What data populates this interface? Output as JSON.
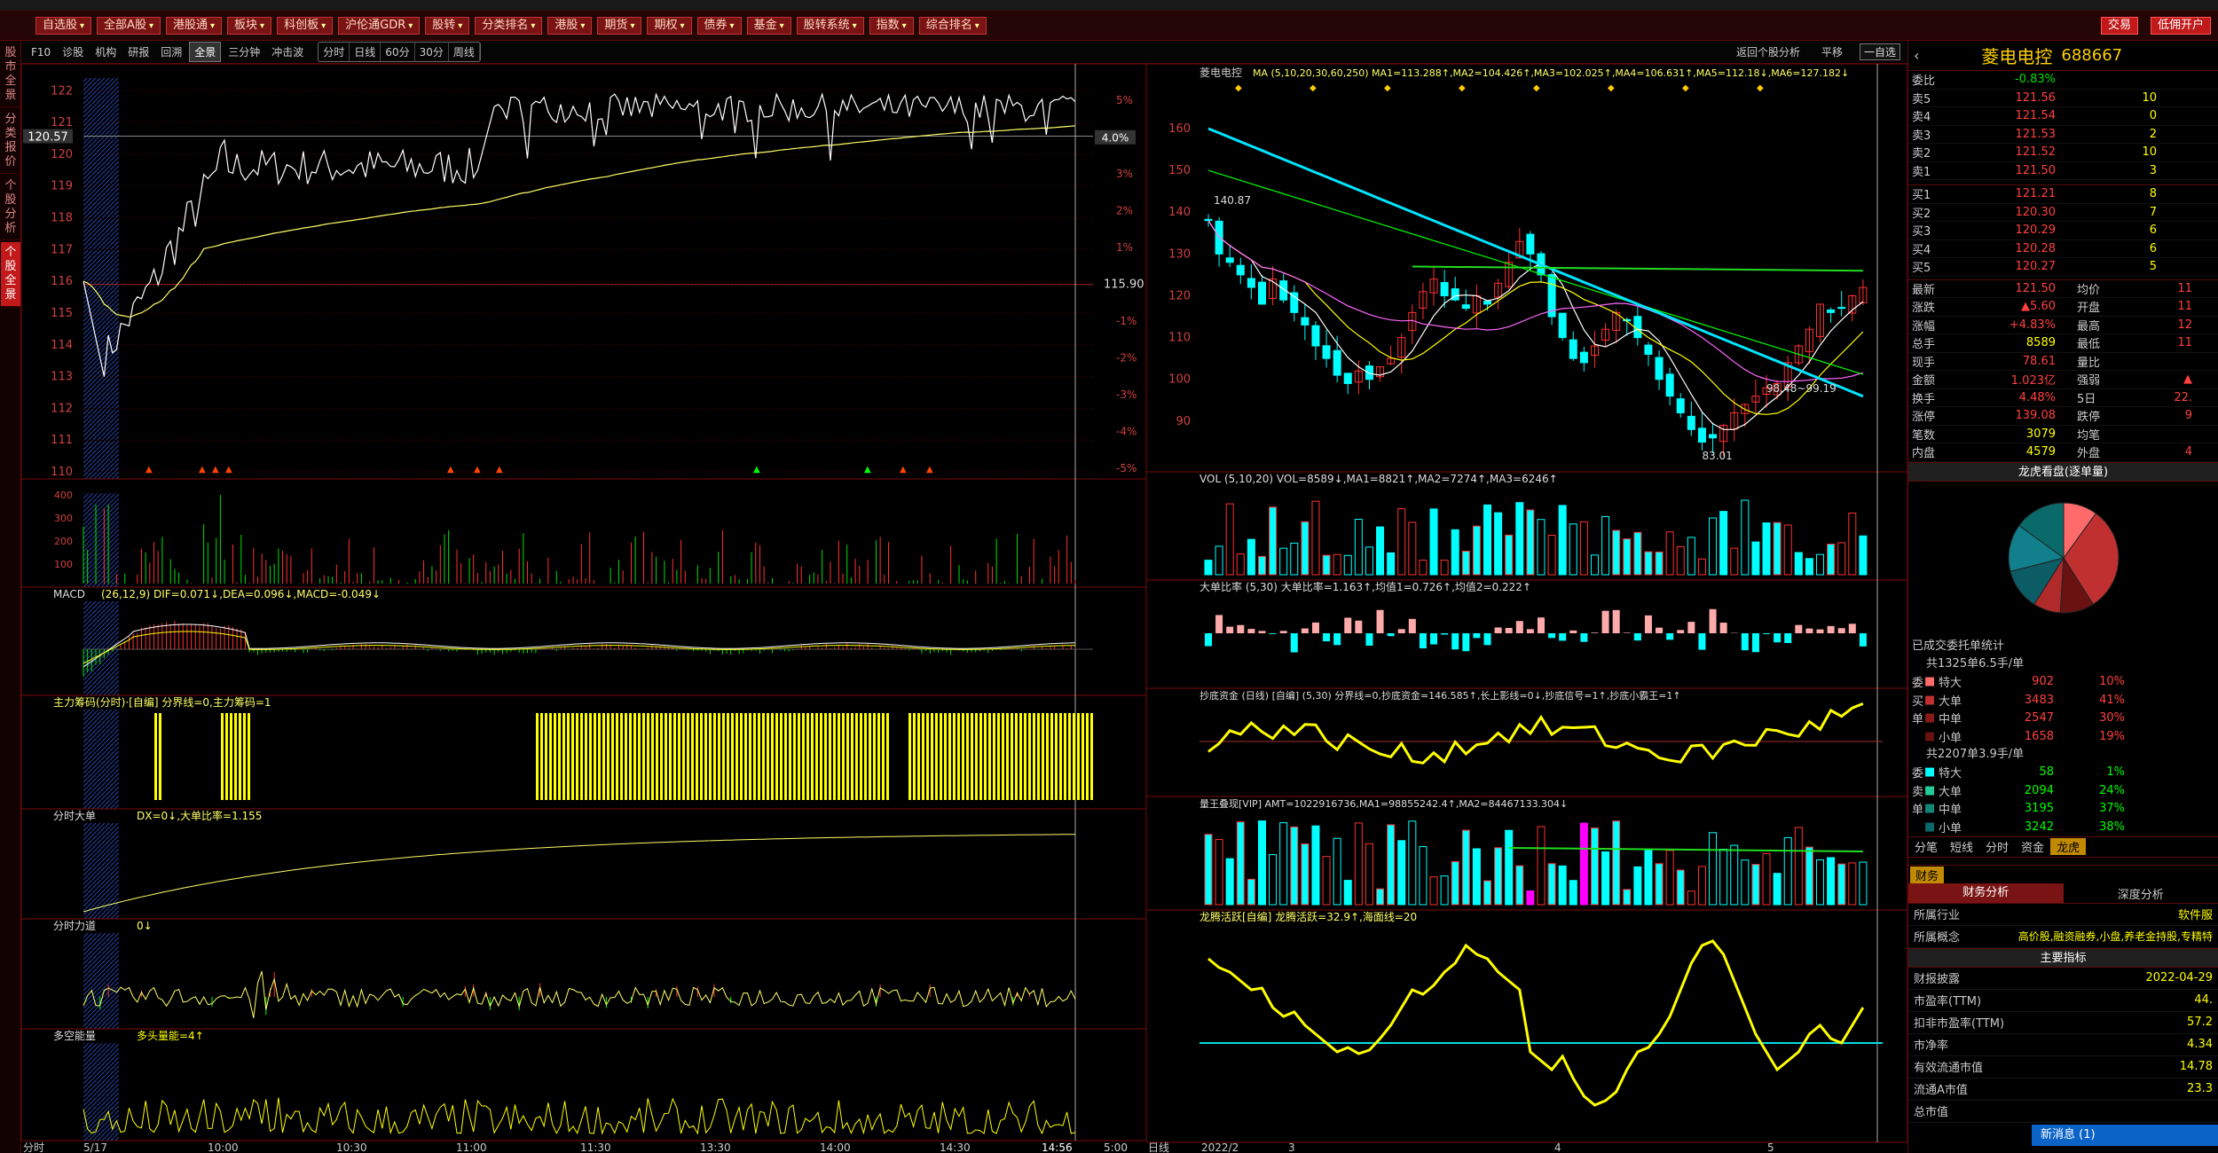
{
  "toolbar": {
    "buttons": [
      "自选股",
      "全部A股",
      "港股通",
      "板块",
      "科创板",
      "沪伦通GDR",
      "股转",
      "分类排名",
      "港股",
      "期货",
      "期权",
      "债券",
      "基金",
      "股转系统",
      "指数",
      "综合排名"
    ],
    "right": [
      "交易",
      "低佣开户"
    ]
  },
  "left_tabs": [
    "股市全景",
    "分类报价",
    "个股分析",
    "个股全景"
  ],
  "intraday_tabs": [
    "F10",
    "诊股",
    "机构",
    "研报",
    "回溯",
    "全景",
    "三分钟",
    "冲击波",
    "分时",
    "日线",
    "60分",
    "30分",
    "周线"
  ],
  "kline_bar": {
    "back": "返回个股分析",
    "flat": "平移",
    "sel": "一自选"
  },
  "colors": {
    "up": "#ff3030",
    "down": "#00ffff",
    "ma_yellow": "#ffff66",
    "accent": "#c21a1a"
  },
  "intraday": {
    "prev_close": "115.90",
    "price_box": "120.57",
    "pct_box": "4.0%",
    "yticks": [
      "122",
      "121",
      "120",
      "119",
      "118",
      "117",
      "116",
      "115",
      "114",
      "113",
      "112",
      "111",
      "110"
    ],
    "pcts": [
      "5%",
      "4%",
      "3%",
      "2%",
      "1%",
      "-1%",
      "-2%",
      "-3%",
      "-4%",
      "-5%"
    ],
    "times": [
      "5/17",
      "10:00",
      "10:30",
      "11:00",
      "11:30",
      "13:30",
      "14:00",
      "14:30",
      "14:56",
      "5:00"
    ],
    "start_label": "分时",
    "macd_label": "MACD",
    "macd_params": "(26,12,9) DIF=0.071↓,DEA=0.096↓,MACD=-0.049↓",
    "chip_label": "主力筹码(分时)·[自编]  分界线=0,主力筹码=1",
    "big_label": "分时大单",
    "big_vals": "DX=0↓,大单比率=1.155",
    "force_label": "分时力道",
    "force_vals": "0↓",
    "energy_label": "多空能量",
    "energy_vals": "多头量能=4↑"
  },
  "kline": {
    "name": "菱电电控",
    "ma_header": "MA  (5,10,20,30,60,250)  MA1=113.288↑,MA2=104.426↑,MA3=102.025↑,MA4=106.631↑,MA5=112.18↓,MA6=127.182↓",
    "yticks": [
      "160",
      "150",
      "140",
      "130",
      "120",
      "110",
      "100",
      "90"
    ],
    "high_mark": "140.87",
    "low_mark": "83.01",
    "range_mark": "98.48~99.19",
    "vol_label": "VOL (5,10,20)  VOL=8589↓,MA1=8821↑,MA2=7274↑,MA3=6246↑",
    "big_ratio_label": "大单比率 (5,30)  大单比率=1.163↑,均值1=0.726↑,均值2=0.222↑",
    "bottom_label": "抄底资金 (日线) [自编]  (5,30)  分界线=0,抄底资金=146.585↑,长上影线=0↓,抄底信号=1↑,抄底小霸王=1↑",
    "volking_label": "量王叠现[VIP]  AMT=1022916736,MA1=98855242.4↑,MA2=84467133.304↓",
    "dragon_label": "龙腾活跃[自编]  龙腾活跃=32.9↑,海面线=20",
    "xlabels": [
      "日线",
      "2022/2",
      "3",
      "4",
      "5"
    ]
  },
  "quote": {
    "name": "菱电电控",
    "code": "688667",
    "ratio_label": "委比",
    "ratio": "-0.83%",
    "asks": [
      [
        "卖5",
        "121.56",
        "10"
      ],
      [
        "卖4",
        "121.54",
        "0"
      ],
      [
        "卖3",
        "121.53",
        "2"
      ],
      [
        "卖2",
        "121.52",
        "10"
      ],
      [
        "卖1",
        "121.50",
        "3"
      ]
    ],
    "bids": [
      [
        "买1",
        "121.21",
        "8"
      ],
      [
        "买2",
        "120.30",
        "7"
      ],
      [
        "买3",
        "120.29",
        "6"
      ],
      [
        "买4",
        "120.28",
        "6"
      ],
      [
        "买5",
        "120.27",
        "5"
      ]
    ],
    "stats": [
      [
        "最新",
        "121.50",
        "均价",
        "11"
      ],
      [
        "涨跌",
        "▲5.60",
        "开盘",
        "11"
      ],
      [
        "涨幅",
        "+4.83%",
        "最高",
        "12"
      ],
      [
        "总手",
        "8589",
        "最低",
        "11"
      ],
      [
        "现手",
        "78.61",
        "量比",
        ""
      ],
      [
        "金额",
        "1.023亿",
        "强弱",
        "▲"
      ],
      [
        "换手",
        "4.48%",
        "5日",
        "22."
      ],
      [
        "涨停",
        "139.08",
        "跌停",
        "9"
      ],
      [
        "笔数",
        "3079",
        "均笔",
        ""
      ],
      [
        "内盘",
        "4579",
        "外盘",
        "4"
      ]
    ],
    "dragon_title": "龙虎看盘(逐单量)",
    "completed": "已成交委托单统计",
    "buy_total": "共1325单6.5手/单",
    "buy_rows": [
      [
        "委",
        "特大",
        "902",
        "10%"
      ],
      [
        "买",
        "大单",
        "3483",
        "41%"
      ],
      [
        "单",
        "中单",
        "2547",
        "30%"
      ],
      [
        "",
        "小单",
        "1658",
        "19%"
      ]
    ],
    "sell_total": "共2207单3.9手/单",
    "sell_rows": [
      [
        "委",
        "特大",
        "58",
        "1%"
      ],
      [
        "卖",
        "大单",
        "2094",
        "24%"
      ],
      [
        "单",
        "中单",
        "3195",
        "37%"
      ],
      [
        "",
        "小单",
        "3242",
        "38%"
      ]
    ],
    "mini_tabs": [
      "分笔",
      "短线",
      "分时",
      "资金",
      "龙虎"
    ],
    "fin_tab": "财务",
    "fin_sub": [
      "财务分析",
      "深度分析"
    ],
    "industry_label": "所属行业",
    "industry": "软件服",
    "concept_label": "所属概念",
    "concept": "高价股,融资融券,小盘,养老金持股,专精特",
    "main_index": "主要指标",
    "fin_rows": [
      [
        "财报披露",
        "2022-04-29"
      ],
      [
        "市盈率(TTM)",
        "44."
      ],
      [
        "扣非市盈率(TTM)",
        "57.2"
      ],
      [
        "市净率",
        "4.34"
      ],
      [
        "有效流通市值",
        "14.78"
      ],
      [
        "流通A市值",
        "23.3"
      ],
      [
        "总市值",
        ""
      ]
    ]
  },
  "news": "新消息 (1)"
}
